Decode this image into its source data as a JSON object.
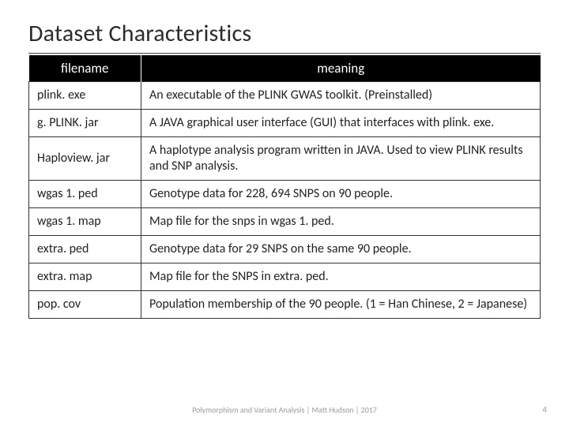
{
  "title": "Dataset Characteristics",
  "headers": {
    "col1": "filename",
    "col2": "meaning"
  },
  "rows": [
    {
      "file": "plink. exe",
      "meaning": "An executable of the PLINK GWAS toolkit. (Preinstalled)"
    },
    {
      "file": "g. PLINK. jar",
      "meaning": "A JAVA graphical user interface (GUI) that interfaces with plink. exe."
    },
    {
      "file": "Haploview. jar",
      "meaning": "A haplotype analysis program written in JAVA. Used to view PLINK results and SNP analysis."
    },
    {
      "file": "wgas 1. ped",
      "meaning": "Genotype data for 228, 694 SNPS on 90 people."
    },
    {
      "file": "wgas 1. map",
      "meaning": "Map file for the snps in wgas 1. ped."
    },
    {
      "file": "extra. ped",
      "meaning": "Genotype data for 29 SNPS on the same 90 people."
    },
    {
      "file": "extra. map",
      "meaning": "Map file for the SNPS in extra. ped."
    },
    {
      "file": "pop. cov",
      "meaning": "Population membership of the 90 people.\n(1 = Han Chinese, 2 = Japanese)"
    }
  ],
  "footer": "Polymorphism and Variant Analysis | Matt Hudson | 2017",
  "page_number": "4"
}
